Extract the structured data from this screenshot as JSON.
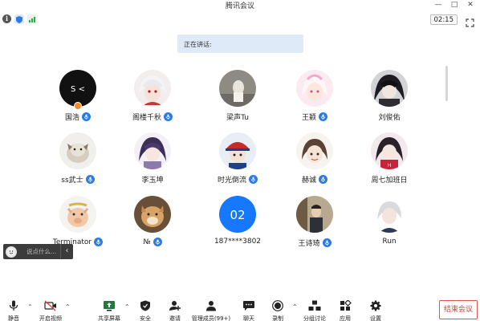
{
  "window": {
    "title": "腾讯会议",
    "controls": [
      "—",
      "□",
      "✕"
    ]
  },
  "infobar": {
    "timer": "02:15",
    "icons": [
      "info-icon",
      "shield-icon",
      "signal-icon",
      "fullscreen-icon"
    ]
  },
  "speaking": {
    "label": "正在讲话:"
  },
  "participants": [
    {
      "name": "国浩",
      "avatar": "dark-initial",
      "avatar_text": "S <",
      "mic": true,
      "host": true
    },
    {
      "name": "阁楼千秋",
      "avatar": "anime-white-hair",
      "mic": true
    },
    {
      "name": "梁声Tu",
      "avatar": "photo-grey",
      "mic": false
    },
    {
      "name": "王颖",
      "avatar": "anime-pink",
      "mic": true
    },
    {
      "name": "刘俊佑",
      "avatar": "anime-dark",
      "mic": false
    },
    {
      "name": "ss武士",
      "avatar": "dog-photo",
      "mic": true
    },
    {
      "name": "李玉坤",
      "avatar": "anime-purple",
      "mic": false
    },
    {
      "name": "时光倒流",
      "avatar": "anime-cap",
      "mic": true
    },
    {
      "name": "赫诚",
      "avatar": "anime-brown",
      "mic": true
    },
    {
      "name": "周七加班日",
      "avatar": "anime-red",
      "mic": false
    },
    {
      "name": "Terminator",
      "avatar": "cartoon-pig",
      "mic": true
    },
    {
      "name": "№",
      "avatar": "shiba-photo",
      "mic": true
    },
    {
      "name": "187****3802",
      "avatar": "number",
      "avatar_text": "02",
      "mic": false
    },
    {
      "name": "王诗琦",
      "avatar": "photo-person",
      "mic": true
    },
    {
      "name": "Run",
      "avatar": "anime-boy",
      "mic": false
    }
  ],
  "chat": {
    "placeholder": "说点什么...",
    "collapse": "‹"
  },
  "toolbar": {
    "buttons": [
      {
        "label": "静音",
        "icon": "microphone-icon"
      },
      {
        "label": "开启视频",
        "icon": "video-off-icon"
      },
      {
        "label": "共享屏幕",
        "icon": "share-screen-icon"
      },
      {
        "label": "安全",
        "icon": "shield-icon"
      },
      {
        "label": "邀请",
        "icon": "invite-icon"
      },
      {
        "label": "管理成员(99+)",
        "icon": "members-icon"
      },
      {
        "label": "聊天",
        "icon": "chat-icon"
      },
      {
        "label": "录制",
        "icon": "record-icon"
      },
      {
        "label": "分组讨论",
        "icon": "breakout-icon"
      },
      {
        "label": "应用",
        "icon": "apps-icon"
      },
      {
        "label": "设置",
        "icon": "settings-icon"
      }
    ],
    "end_label": "结束会议"
  },
  "colors": {
    "accent": "#2c7be5",
    "end": "#e03a3a",
    "speaking_bg": "#dfeaf9",
    "number_avatar": "#1677ff"
  }
}
